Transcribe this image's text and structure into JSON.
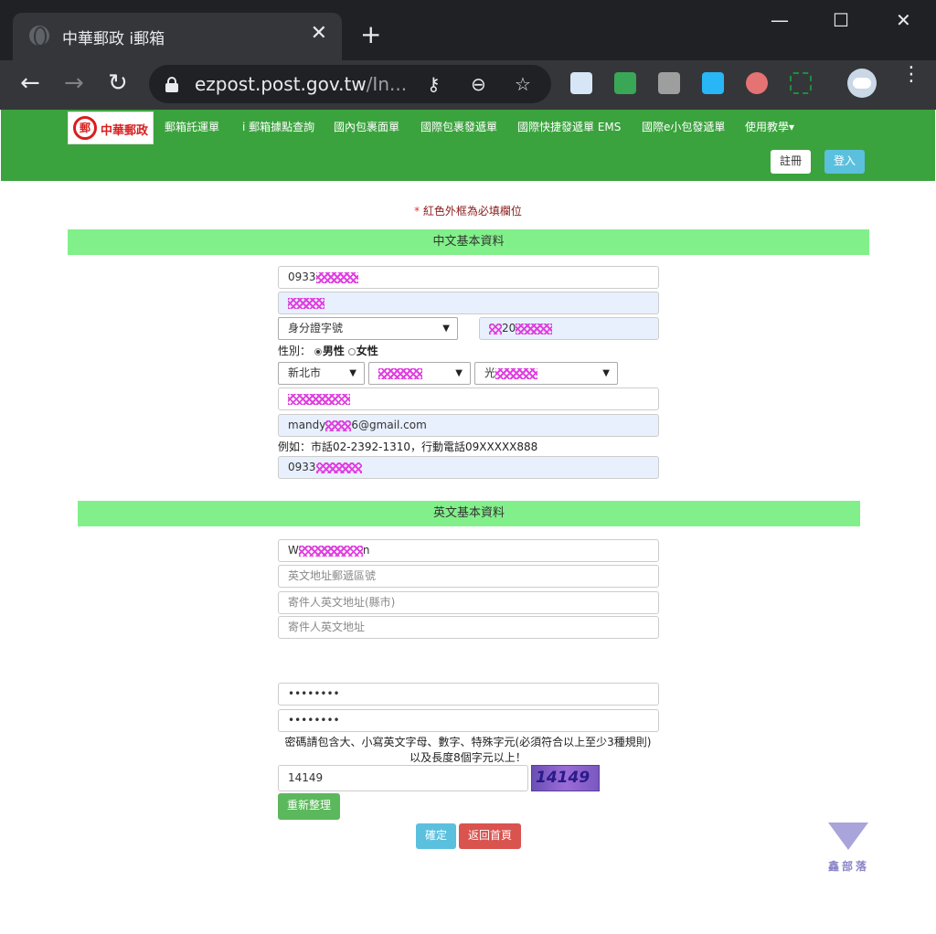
{
  "browser": {
    "tab_title": "中華郵政 i郵箱",
    "tab_close": "✕",
    "new_tab": "+",
    "win_min": "—",
    "win_max": "☐",
    "win_close": "✕",
    "url_host": "ezpost.post.gov.tw",
    "url_rest": "/In...",
    "icons": [
      "globe-icon",
      "back-icon",
      "forward-icon",
      "reload-icon",
      "lock-icon",
      "key-icon",
      "zoom-out-icon",
      "star-icon",
      "profile-avatar-icon",
      "menu-icon"
    ]
  },
  "site": {
    "logo_text": "中華郵政",
    "logo_mark": "郵",
    "menu": [
      "郵箱託運單",
      "i 郵箱據點查詢",
      "國內包裹面單",
      "國際包裹發遞單",
      "國際快捷發遞單 EMS",
      "國際e小包發遞單",
      "使用教學▾"
    ],
    "register_label": "註冊",
    "login_label": "登入"
  },
  "form": {
    "required_note_star": "*",
    "required_note": " 紅色外框為必填欄位",
    "section_cn": "中文基本資料",
    "phone_value": "0933",
    "id_type_selected": "身分證字號",
    "id_value_prefix": "",
    "id_value_mid": "20",
    "gender_label": "性別：",
    "gender_male": "男性",
    "gender_female": "女性",
    "city_selected": "新北市",
    "district_selected": "",
    "road_prefix": "光",
    "email_value": "mandy",
    "email_suffix": "6@gmail.com",
    "phone_example": "例如：市話02-2392-1310，行動電話09XXXXX888",
    "mobile_value": "0933",
    "section_en": "英文基本資料",
    "en_name_start": "W",
    "en_name_end": "n",
    "en_zip_placeholder": "英文地址郵遞區號",
    "en_city_placeholder": "寄件人英文地址(縣市)",
    "en_address_placeholder": "寄件人英文地址",
    "password_mask": "••••••••",
    "confirm_mask": "••••••••",
    "password_rule_1": "密碼請包含大、小寫英文字母、數字、特殊字元(必須符合以上至少3種規則)",
    "password_rule_2": "以及長度8個字元以上！",
    "captcha_input": "14149",
    "captcha_image_text": "14149",
    "refresh_label": "重新整理",
    "confirm_label": "確定",
    "back_home_label": "返回首頁"
  },
  "watermark_text": "鑫部落",
  "colors": {
    "chrome_dark": "#202124",
    "header_green": "#3ba33e",
    "section_green": "#82f08a",
    "register_bg": "#ffffff",
    "login_bg": "#5bc0de",
    "refresh_bg": "#5cb85c",
    "confirm_bg": "#5bc0de",
    "back_bg": "#d9534f",
    "required_text": "#8b1a1a"
  }
}
